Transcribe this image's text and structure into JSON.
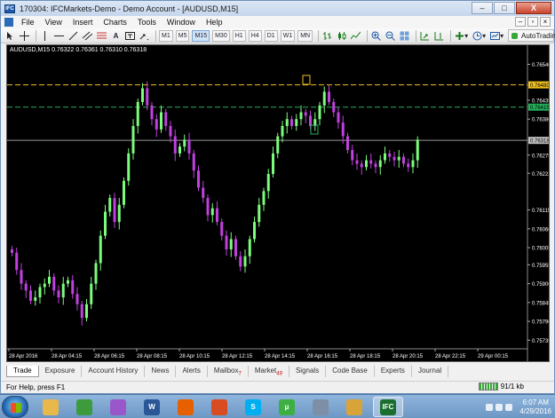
{
  "window": {
    "title": "170304: IFCMarkets-Demo - Demo Account - [AUDUSD,M15]",
    "minimize": "–",
    "maximize": "□",
    "close": "X"
  },
  "menu": {
    "items": [
      "File",
      "View",
      "Insert",
      "Charts",
      "Tools",
      "Window",
      "Help"
    ],
    "mdi_minimize": "–",
    "mdi_restore": "▫",
    "mdi_close": "×"
  },
  "toolbar": {
    "timeframes": [
      "M1",
      "M5",
      "M15",
      "M30",
      "H1",
      "H4",
      "D1",
      "W1",
      "MN"
    ],
    "active_timeframe": "M15",
    "autotrading": "AutoTrading"
  },
  "chart": {
    "symbol_line": "AUDUSD,M15  0.76322 0.76361 0.76310 0.76318",
    "price_levels": [
      "0.76540",
      "0.76435",
      "0.76380",
      "0.76275",
      "0.76222",
      "0.76115",
      "0.76060",
      "0.76005",
      "0.75955",
      "0.75900",
      "0.75845",
      "0.75790",
      "0.75735"
    ],
    "time_labels": [
      "28 Apr 2016",
      "28 Apr 04:15",
      "28 Apr 06:15",
      "28 Apr 08:15",
      "28 Apr 10:15",
      "28 Apr 12:15",
      "28 Apr 14:15",
      "28 Apr 16:15",
      "28 Apr 18:15",
      "28 Apr 20:15",
      "28 Apr 22:15",
      "29 Apr 00:15"
    ],
    "level_tp": "0.76480",
    "level_entry": "0.76415",
    "level_bid": "0.76318",
    "colors": {
      "background": "#000000",
      "bull": "#7CFC7C",
      "bear": "#C040E0",
      "take_profit_line": "#F0C020",
      "entry_line": "#22B05A",
      "bid_line": "#9A9A9A"
    }
  },
  "tabs": {
    "items": [
      {
        "label": "Trade",
        "badge": ""
      },
      {
        "label": "Exposure",
        "badge": ""
      },
      {
        "label": "Account History",
        "badge": ""
      },
      {
        "label": "News",
        "badge": ""
      },
      {
        "label": "Alerts",
        "badge": ""
      },
      {
        "label": "Mailbox",
        "badge": "7"
      },
      {
        "label": "Market",
        "badge": "49"
      },
      {
        "label": "Signals",
        "badge": ""
      },
      {
        "label": "Code Base",
        "badge": ""
      },
      {
        "label": "Experts",
        "badge": ""
      },
      {
        "label": "Journal",
        "badge": ""
      }
    ],
    "active": "Trade"
  },
  "status": {
    "help": "For Help, press F1",
    "connection": "91/1 kb"
  },
  "taskbar": {
    "apps": [
      {
        "name": "explorer-folder-icon",
        "color": "#e8b84a",
        "glyph": ""
      },
      {
        "name": "chrome-icon",
        "color": "#3d9b3d",
        "glyph": ""
      },
      {
        "name": "quill-icon",
        "color": "#9a57c9",
        "glyph": ""
      },
      {
        "name": "word-icon",
        "color": "#2b5797",
        "glyph": "W"
      },
      {
        "name": "firefox-icon",
        "color": "#e66000",
        "glyph": ""
      },
      {
        "name": "media-player-icon",
        "color": "#d94b23",
        "glyph": ""
      },
      {
        "name": "skype-icon",
        "color": "#00aff0",
        "glyph": "S"
      },
      {
        "name": "utorrent-icon",
        "color": "#3eb043",
        "glyph": "μ"
      },
      {
        "name": "calculator-icon",
        "color": "#7d8fa6",
        "glyph": ""
      },
      {
        "name": "file-manager-icon",
        "color": "#d9a437",
        "glyph": ""
      },
      {
        "name": "ifc-terminal-icon",
        "color": "#1a6e2e",
        "glyph": "IFC"
      }
    ],
    "time": "6:07 AM",
    "date": "4/29/2016"
  }
}
